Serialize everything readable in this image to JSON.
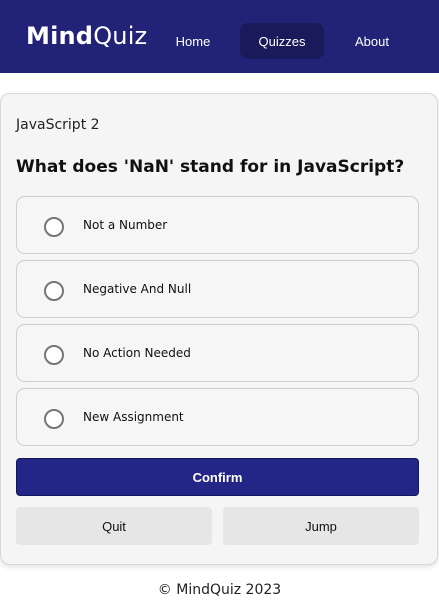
{
  "navbar": {
    "brand_bold": "Mind",
    "brand_light": "Quiz",
    "items": [
      {
        "label": "Home"
      },
      {
        "label": "Quizzes",
        "active": true
      },
      {
        "label": "About"
      }
    ],
    "background": "#222277"
  },
  "quiz": {
    "name": "JavaScript 2",
    "question": "What does 'NaN' stand for in JavaScript?",
    "options": [
      {
        "label": "Not a Number",
        "selected": false
      },
      {
        "label": "Negative And Null",
        "selected": false
      },
      {
        "label": "No Action Needed",
        "selected": false
      },
      {
        "label": "New Assignment",
        "selected": false
      }
    ]
  },
  "actions": {
    "confirm_label": "Confirm",
    "quit_label": "Quit",
    "jump_label": "Jump",
    "confirm_color": "#242687"
  },
  "footer": {
    "text": "© MindQuiz 2023"
  }
}
